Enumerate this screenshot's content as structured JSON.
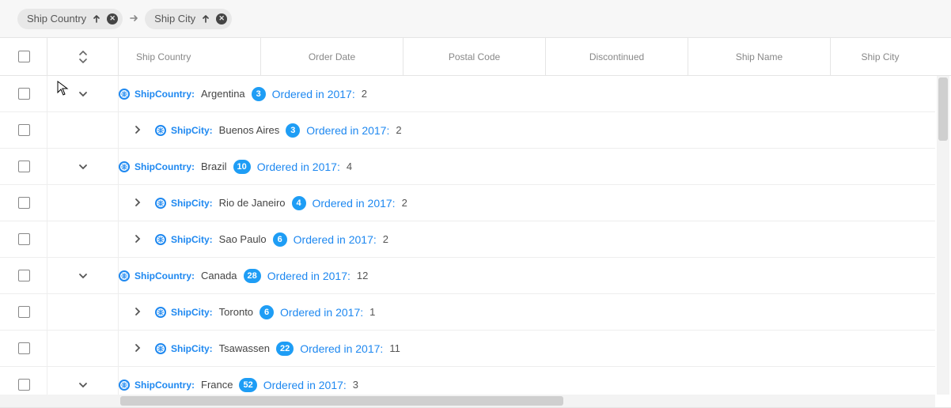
{
  "groupbar": {
    "chips": [
      {
        "label": "Ship Country"
      },
      {
        "label": "Ship City"
      }
    ]
  },
  "columns": {
    "ship_country": "Ship Country",
    "order_date": "Order Date",
    "postal_code": "Postal Code",
    "discontinued": "Discontinued",
    "ship_name": "Ship Name",
    "ship_city": "Ship City"
  },
  "labels": {
    "country_key": "ShipCountry:",
    "city_key": "ShipCity:",
    "ordered": "Ordered in 2017:"
  },
  "rows": [
    {
      "level": 0,
      "expanded": true,
      "key_ref": "country_key",
      "value": "Argentina",
      "badge": "3",
      "ordered_n": "2"
    },
    {
      "level": 1,
      "expanded": false,
      "key_ref": "city_key",
      "value": "Buenos Aires",
      "badge": "3",
      "ordered_n": "2"
    },
    {
      "level": 0,
      "expanded": true,
      "key_ref": "country_key",
      "value": "Brazil",
      "badge": "10",
      "ordered_n": "4"
    },
    {
      "level": 1,
      "expanded": false,
      "key_ref": "city_key",
      "value": "Rio de Janeiro",
      "badge": "4",
      "ordered_n": "2"
    },
    {
      "level": 1,
      "expanded": false,
      "key_ref": "city_key",
      "value": "Sao Paulo",
      "badge": "6",
      "ordered_n": "2"
    },
    {
      "level": 0,
      "expanded": true,
      "key_ref": "country_key",
      "value": "Canada",
      "badge": "28",
      "ordered_n": "12"
    },
    {
      "level": 1,
      "expanded": false,
      "key_ref": "city_key",
      "value": "Toronto",
      "badge": "6",
      "ordered_n": "1"
    },
    {
      "level": 1,
      "expanded": false,
      "key_ref": "city_key",
      "value": "Tsawassen",
      "badge": "22",
      "ordered_n": "11"
    },
    {
      "level": 0,
      "expanded": true,
      "key_ref": "country_key",
      "value": "France",
      "badge": "52",
      "ordered_n": "3"
    }
  ]
}
